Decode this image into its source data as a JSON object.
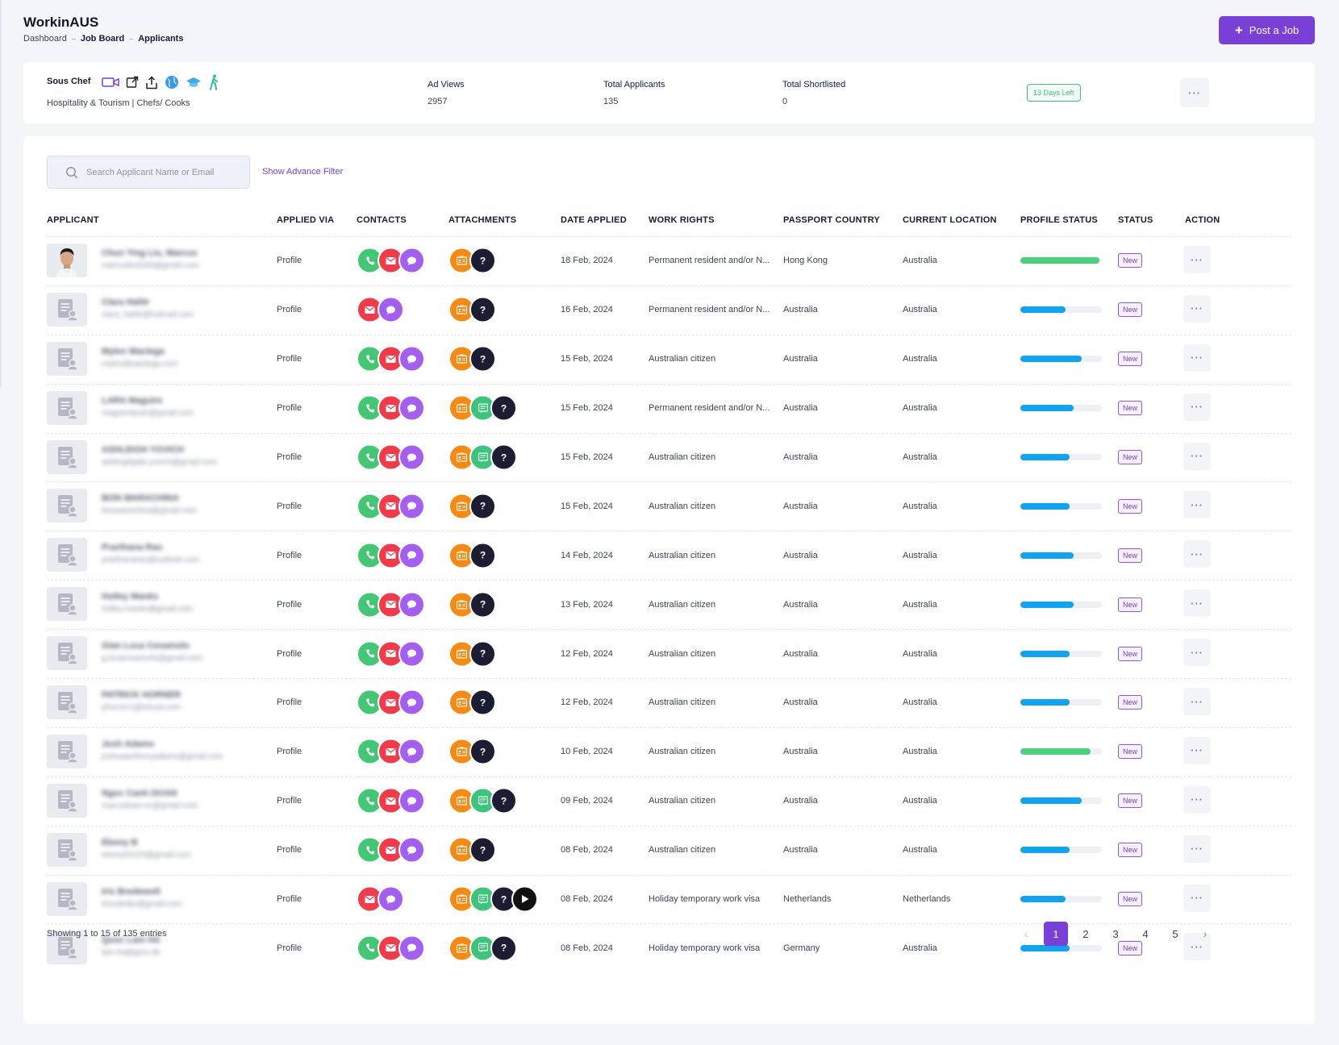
{
  "header": {
    "app_title": "WorkinAUS",
    "breadcrumbs": [
      "Dashboard",
      "Job Board",
      "Applicants"
    ],
    "post_button": "Post a Job"
  },
  "job": {
    "title": "Sous Chef",
    "category": "Hospitality & Tourism | Chefs/ Cooks",
    "icons": [
      "video-icon",
      "external-link-icon",
      "share-icon",
      "globe-icon",
      "graduation-cap-icon",
      "walking-person-icon"
    ],
    "stats": [
      {
        "label": "Ad Views",
        "value": "2957"
      },
      {
        "label": "Total Applicants",
        "value": "135"
      },
      {
        "label": "Total Shortlisted",
        "value": "0"
      }
    ],
    "days_left": "13 Days Left"
  },
  "search": {
    "placeholder": "Search Applicant Name or Email",
    "advance_filter": "Show Advance Filter"
  },
  "table": {
    "columns": [
      "APPLICANT",
      "APPLIED VIA",
      "CONTACTS",
      "ATTACHMENTS",
      "DATE APPLIED",
      "WORK RIGHTS",
      "PASSPORT COUNTRY",
      "CURRENT LOCATION",
      "PROFILE STATUS",
      "STATUS",
      "ACTION"
    ],
    "rows": [
      {
        "name": "Chun Ying Liu, Marcus",
        "email": "marcusliu0205@gmail.com",
        "photo": true,
        "via": "Profile",
        "contacts": [
          "phone",
          "mail",
          "chat"
        ],
        "attachments": [
          "cv",
          "question"
        ],
        "date": "18 Feb, 2024",
        "work_rights": "Permanent resident and/or N...",
        "passport": "Hong Kong",
        "location": "Australia",
        "profile_pct": 0.97,
        "profile_color": "#4cd07d",
        "status": "New"
      },
      {
        "name": "Clara Hafdr",
        "email": "clara_hafdr@hotmail.com",
        "photo": false,
        "via": "Profile",
        "contacts": [
          "mail",
          "chat"
        ],
        "attachments": [
          "cv",
          "question"
        ],
        "date": "16 Feb, 2024",
        "work_rights": "Permanent resident and/or N...",
        "passport": "Australia",
        "location": "Australia",
        "profile_pct": 0.55,
        "profile_color": "#12a3f0",
        "status": "New"
      },
      {
        "name": "Myles Waclega",
        "email": "myles@waclega.com",
        "photo": false,
        "via": "Profile",
        "contacts": [
          "phone",
          "mail",
          "chat"
        ],
        "attachments": [
          "cv",
          "question"
        ],
        "date": "15 Feb, 2024",
        "work_rights": "Australian citizen",
        "passport": "Australia",
        "location": "Australia",
        "profile_pct": 0.75,
        "profile_color": "#12a3f0",
        "status": "New"
      },
      {
        "name": "LARA Maguire",
        "email": "maguirelarah@gmail.com",
        "photo": false,
        "via": "Profile",
        "contacts": [
          "phone",
          "mail",
          "chat"
        ],
        "attachments": [
          "cv",
          "note",
          "question"
        ],
        "date": "15 Feb, 2024",
        "work_rights": "Permanent resident and/or N...",
        "passport": "Australia",
        "location": "Australia",
        "profile_pct": 0.65,
        "profile_color": "#12a3f0",
        "status": "New"
      },
      {
        "name": "ASHLEIGH YOVICH",
        "email": "ashleighjade.yovich@gmail.com",
        "photo": false,
        "via": "Profile",
        "contacts": [
          "phone",
          "mail",
          "chat"
        ],
        "attachments": [
          "cv",
          "note",
          "question"
        ],
        "date": "15 Feb, 2024",
        "work_rights": "Australian citizen",
        "passport": "Australia",
        "location": "Australia",
        "profile_pct": 0.6,
        "profile_color": "#12a3f0",
        "status": "New"
      },
      {
        "name": "BON WARACHINA",
        "email": "bonwarachina@gmail.com",
        "photo": false,
        "via": "Profile",
        "contacts": [
          "phone",
          "mail",
          "chat"
        ],
        "attachments": [
          "cv",
          "question"
        ],
        "date": "15 Feb, 2024",
        "work_rights": "Australian citizen",
        "passport": "Australia",
        "location": "Australia",
        "profile_pct": 0.6,
        "profile_color": "#12a3f0",
        "status": "New"
      },
      {
        "name": "Prarthana Rao",
        "email": "prarthanarao@outlook.com",
        "photo": false,
        "via": "Profile",
        "contacts": [
          "phone",
          "mail",
          "chat"
        ],
        "attachments": [
          "cv",
          "question"
        ],
        "date": "14 Feb, 2024",
        "work_rights": "Australian citizen",
        "passport": "Australia",
        "location": "Australia",
        "profile_pct": 0.65,
        "profile_color": "#12a3f0",
        "status": "New"
      },
      {
        "name": "Holley Manks",
        "email": "holley.manks@gmail.com",
        "photo": false,
        "via": "Profile",
        "contacts": [
          "phone",
          "mail",
          "chat"
        ],
        "attachments": [
          "cv",
          "question"
        ],
        "date": "13 Feb, 2024",
        "work_rights": "Australian citizen",
        "passport": "Australia",
        "location": "Australia",
        "profile_pct": 0.65,
        "profile_color": "#12a3f0",
        "status": "New"
      },
      {
        "name": "Gian Luca Cesamolo",
        "email": "g.lucacesamolo@gmail.com",
        "photo": false,
        "via": "Profile",
        "contacts": [
          "phone",
          "mail",
          "chat"
        ],
        "attachments": [
          "cv",
          "question"
        ],
        "date": "12 Feb, 2024",
        "work_rights": "Australian citizen",
        "passport": "Australia",
        "location": "Australia",
        "profile_pct": 0.6,
        "profile_color": "#12a3f0",
        "status": "New"
      },
      {
        "name": "PATRICK HORNER",
        "email": "phorner1@icloud.com",
        "photo": false,
        "via": "Profile",
        "contacts": [
          "phone",
          "mail",
          "chat"
        ],
        "attachments": [
          "cv",
          "question"
        ],
        "date": "12 Feb, 2024",
        "work_rights": "Australian citizen",
        "passport": "Australia",
        "location": "Australia",
        "profile_pct": 0.6,
        "profile_color": "#12a3f0",
        "status": "New"
      },
      {
        "name": "Josh Adams",
        "email": "joshuaanthonyadams@gmail.com",
        "photo": false,
        "via": "Profile",
        "contacts": [
          "phone",
          "mail",
          "chat"
        ],
        "attachments": [
          "cv",
          "question"
        ],
        "date": "10 Feb, 2024",
        "work_rights": "Australian citizen",
        "passport": "Australia",
        "location": "Australia",
        "profile_pct": 0.86,
        "profile_color": "#4cd07d",
        "status": "New"
      },
      {
        "name": "Ngoc Canh DOAN",
        "email": "marcodoan.nc@gmail.com",
        "photo": false,
        "via": "Profile",
        "contacts": [
          "phone",
          "mail",
          "chat"
        ],
        "attachments": [
          "cv",
          "note",
          "question"
        ],
        "date": "09 Feb, 2024",
        "work_rights": "Australian citizen",
        "passport": "Australia",
        "location": "Australia",
        "profile_pct": 0.75,
        "profile_color": "#12a3f0",
        "status": "New"
      },
      {
        "name": "Ebony B",
        "email": "ebony03103@gmail.com",
        "photo": false,
        "via": "Profile",
        "contacts": [
          "phone",
          "mail",
          "chat"
        ],
        "attachments": [
          "cv",
          "question"
        ],
        "date": "08 Feb, 2024",
        "work_rights": "Australian citizen",
        "passport": "Australia",
        "location": "Australia",
        "profile_pct": 0.6,
        "profile_color": "#12a3f0",
        "status": "New"
      },
      {
        "name": "Iris Bredewolt",
        "email": "irissatelijn@gmail.com",
        "photo": false,
        "via": "Profile",
        "contacts": [
          "mail",
          "chat"
        ],
        "attachments": [
          "cv",
          "note",
          "question",
          "play"
        ],
        "date": "08 Feb, 2024",
        "work_rights": "Holiday temporary work visa",
        "passport": "Netherlands",
        "location": "Netherlands",
        "profile_pct": 0.55,
        "profile_color": "#12a3f0",
        "status": "New"
      },
      {
        "name": "Quoc Lam HA",
        "email": "lam.ha@gmx.de",
        "photo": false,
        "via": "Profile",
        "contacts": [
          "phone",
          "mail",
          "chat"
        ],
        "attachments": [
          "cv",
          "note",
          "question"
        ],
        "date": "08 Feb, 2024",
        "work_rights": "Holiday temporary work visa",
        "passport": "Germany",
        "location": "Australia",
        "profile_pct": 0.6,
        "profile_color": "#12a3f0",
        "status": "New"
      }
    ]
  },
  "footer": {
    "showing": "Showing 1 to 15 of 135 entries",
    "pages": [
      "1",
      "2",
      "3",
      "4",
      "5"
    ],
    "active_page": "1",
    "prev": "‹",
    "next": "›"
  }
}
